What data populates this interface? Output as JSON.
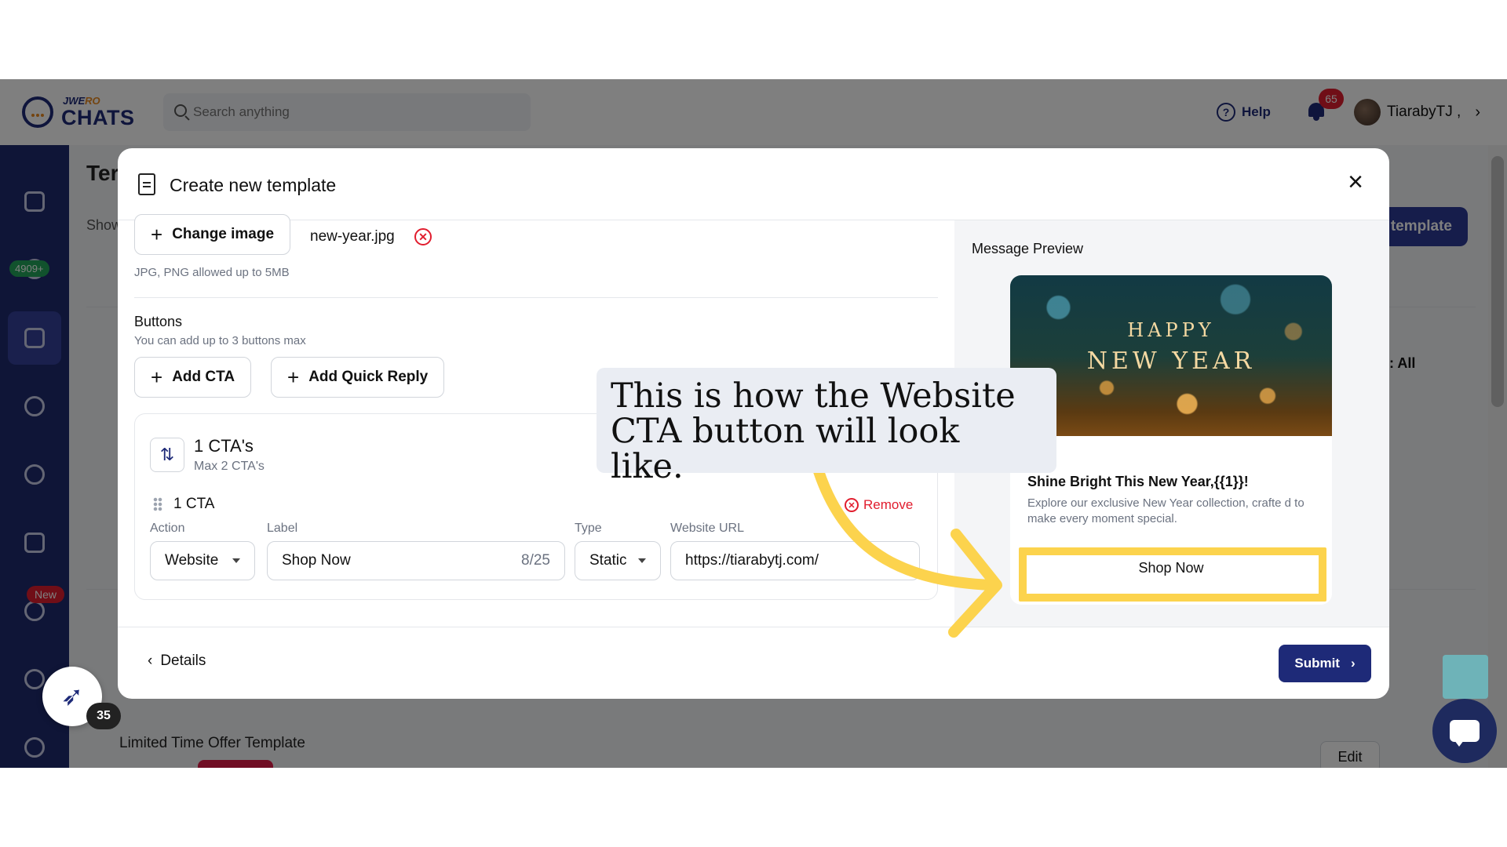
{
  "topbar": {
    "brand_top": "JWE",
    "brand_top_accent": "RO",
    "brand": "CHATS",
    "search_placeholder": "Search anything",
    "help_label": "Help",
    "notif_count": "65",
    "user_name": "TiarabyTJ ,"
  },
  "sidebar": {
    "chat_badge": "4909+",
    "new_badge": "New"
  },
  "background": {
    "page_title": "Ter",
    "show_label": "Show",
    "create_button": "template",
    "filter_label": ": All",
    "row_title": "Limited Time Offer Template",
    "edit_label": "Edit"
  },
  "modal": {
    "title": "Create new template",
    "change_image_label": "Change image",
    "file_name": "new-year.jpg",
    "image_hint": "JPG, PNG allowed up to 5MB",
    "buttons_title": "Buttons",
    "buttons_hint": "You can add up to 3 buttons max",
    "add_cta_label": "Add CTA",
    "add_quick_reply_label": "Add Quick Reply",
    "cta_count": "1 CTA's",
    "cta_max": "Max 2 CTA's",
    "cta_item_label": "1 CTA",
    "remove_label": "Remove",
    "fields": {
      "action_label": "Action",
      "action_value": "Website",
      "label_label": "Label",
      "label_value": "Shop Now",
      "label_counter": "8/25",
      "type_label": "Type",
      "type_value": "Static",
      "url_label": "Website URL",
      "url_value": "https://tiarabytj.com/"
    },
    "preview": {
      "title": "Message Preview",
      "image_text_1": "HAPPY",
      "image_text_2": "NEW YEAR",
      "heading": "Shine Bright This New Year,{{1}}!",
      "body": "Explore our exclusive New Year collection, crafte d to make every moment special.",
      "button_label": "Shop Now"
    },
    "back_label": "Details",
    "submit_label": "Submit"
  },
  "tooltip": {
    "text": "This is how the Website CTA button will look like."
  },
  "widgets": {
    "rocket_badge": "35"
  },
  "colors": {
    "primary": "#1e2a78",
    "highlight": "#fcd34d",
    "danger": "#e11d2e"
  }
}
